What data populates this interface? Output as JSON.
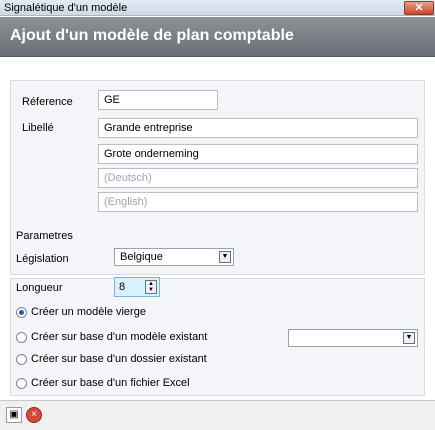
{
  "window": {
    "title": "Signalétique d'un modèle",
    "close_glyph": "✕"
  },
  "header": {
    "title": "Ajout d'un modèle de plan comptable"
  },
  "form": {
    "reference": {
      "label": "Réference",
      "value": "GE"
    },
    "libelle": {
      "label": "Libellé",
      "fr": "Grande entreprise",
      "nl": "Grote onderneming",
      "de_placeholder": "(Deutsch)",
      "en_placeholder": "(English)"
    },
    "parametres": {
      "label": "Parametres"
    },
    "legislation": {
      "label": "Législation",
      "value": "Belgique"
    },
    "longueur": {
      "label": "Longueur",
      "value": "8"
    },
    "options": [
      {
        "label": "Créer un modèle vierge",
        "checked": true
      },
      {
        "label": "Créer sur base d'un modèle existant",
        "checked": false
      },
      {
        "label": "Créer sur base d'un dossier existant",
        "checked": false
      },
      {
        "label": "Créer sur base d'un fichier Excel",
        "checked": false
      }
    ],
    "existing_model_select": {
      "value": ""
    }
  },
  "toolbar": {
    "save_icon": "save-icon",
    "cancel_icon": "cancel-icon"
  },
  "colors": {
    "header_bg": "#7b7f86",
    "spin_bg": "#d8f1ff",
    "close_btn": "#c9482b"
  }
}
